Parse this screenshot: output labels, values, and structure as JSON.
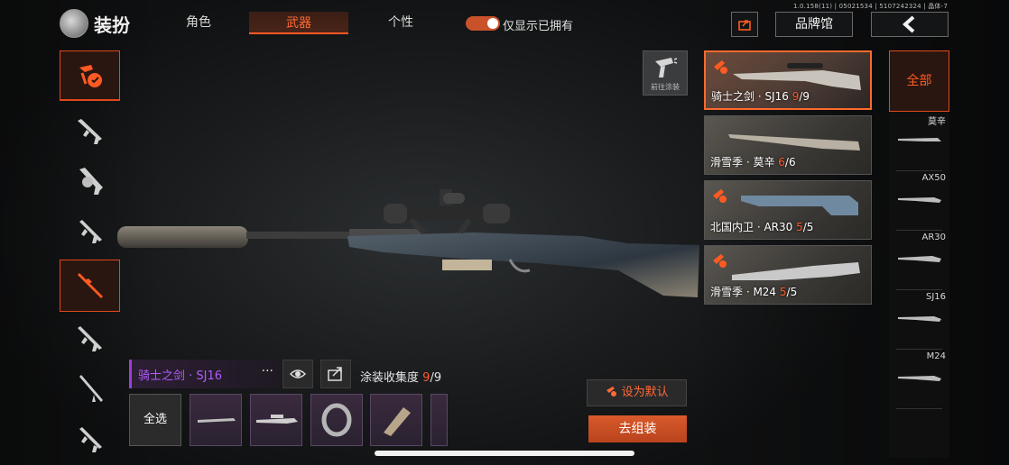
{
  "header": {
    "title": "装扮",
    "tabs": [
      {
        "label": "角色",
        "active": false
      },
      {
        "label": "武器",
        "active": true
      },
      {
        "label": "个性",
        "active": false
      }
    ],
    "toggle": {
      "label": "仅显示已拥有",
      "on": true
    },
    "version": "1.0.158(11) | 05021534 | 5107242324 | 晶体-7",
    "brand_hall_label": "品牌馆"
  },
  "rail": {
    "items": [
      "emblem-icon",
      "assault-rifle-icon",
      "drum-smg-icon",
      "smg-icon",
      "sniper-rifle-icon",
      "rifle-icon",
      "dmr-icon",
      "carbine-icon"
    ],
    "active_index": 4
  },
  "paint_shortcut": {
    "label": "前往涂装"
  },
  "skins": [
    {
      "name": "骑士之剑 · SJ16",
      "owned": "9",
      "total": "9",
      "selected": true,
      "flag": true
    },
    {
      "name": "滑雪季 · 莫辛",
      "owned": "6",
      "total": "6",
      "selected": false,
      "flag": false
    },
    {
      "name": "北国内卫 · AR30",
      "owned": "5",
      "total": "5",
      "selected": false,
      "flag": true
    },
    {
      "name": "滑雪季 · M24",
      "owned": "5",
      "total": "5",
      "selected": false,
      "flag": true
    }
  ],
  "filter": {
    "all_label": "全部",
    "items": [
      "莫辛",
      "AX50",
      "AR30",
      "SJ16",
      "M24"
    ]
  },
  "current": {
    "name": "骑士之剑 · SJ16",
    "more": "···",
    "collect_label": "涂装收集度",
    "collect_owned": "9",
    "collect_total": "/9"
  },
  "parts": {
    "select_all": "全选"
  },
  "actions": {
    "set_default": "设为默认",
    "assemble": "去组装"
  },
  "colors": {
    "accent": "#ff5a22",
    "skin_name": "#b25bff"
  }
}
